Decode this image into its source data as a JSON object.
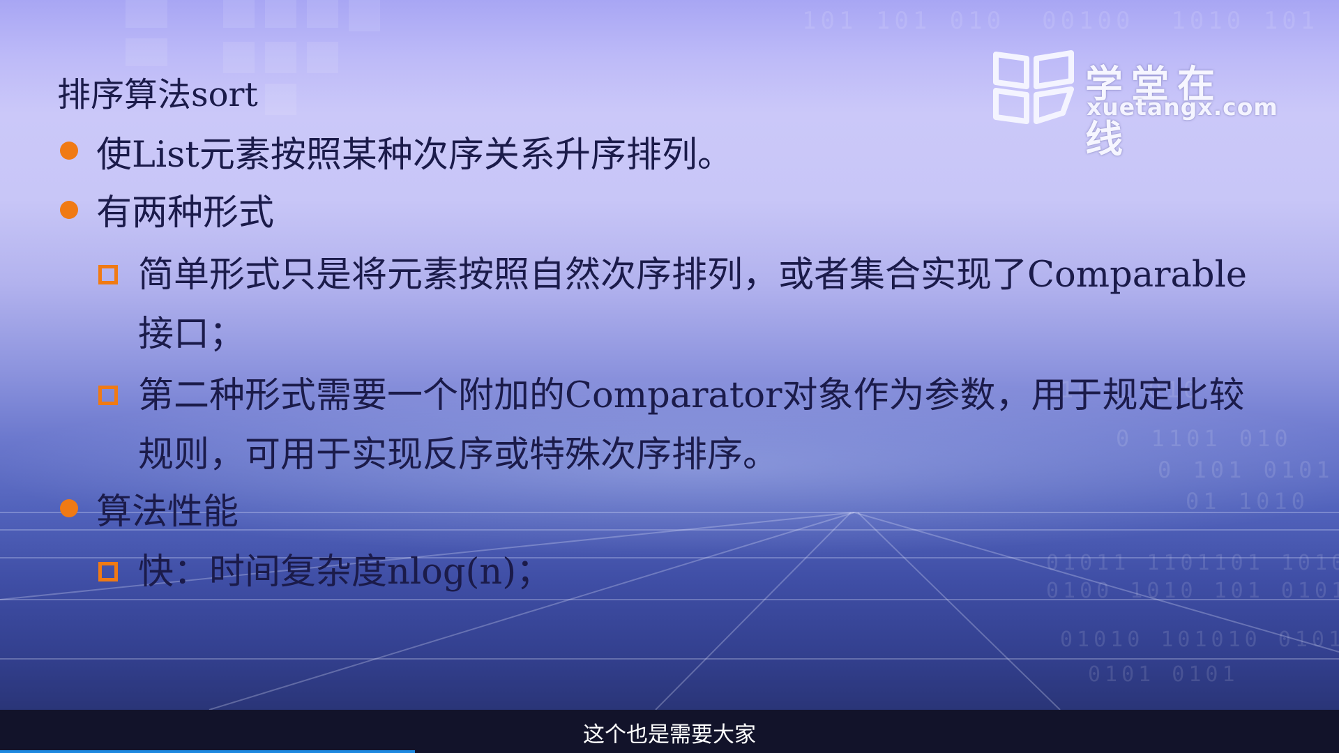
{
  "slide": {
    "title": "排序算法sort",
    "bullets": [
      "使List元素按照某种次序关系升序排列。",
      "有两种形式",
      "算法性能"
    ],
    "sub_items": [
      "简单形式只是将元素按照自然次序排列，或者集合实现了Comparable",
      "接口；",
      "第二种形式需要一个附加的Comparator对象作为参数，用于规定比较",
      "规则，可用于实现反序或特殊次序排序。",
      "快：时间复杂度nlog(n)；"
    ]
  },
  "logo": {
    "name": "学堂在线",
    "domain": "xuetangx.com",
    "icon": "book-logo-icon"
  },
  "subtitle": {
    "text": "这个也是需要大家"
  },
  "playback": {
    "progress_fraction": 0.31
  },
  "colors": {
    "bullet": "#f07a14",
    "text": "#1b1b4a",
    "subtitle_bg": "#12132a",
    "progress": "#1d89e0"
  }
}
